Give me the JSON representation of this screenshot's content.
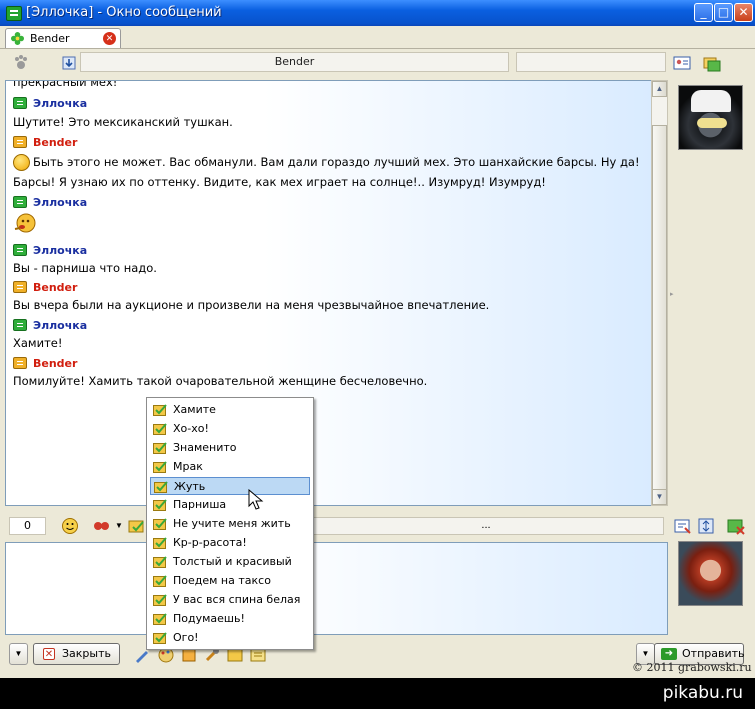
{
  "window": {
    "title": "[Эллочка] - Окно сообщений"
  },
  "tab": {
    "label": "Bender"
  },
  "contact": {
    "name": "Bender"
  },
  "chat": {
    "lines": [
      {
        "type": "text",
        "text": "прекрасный мех!"
      },
      {
        "type": "sender",
        "who": "e",
        "text": "Эллочка"
      },
      {
        "type": "text",
        "text": "Шутите! Это мексиканский тушкан."
      },
      {
        "type": "sender",
        "who": "b",
        "text": "Bender"
      },
      {
        "type": "text",
        "text": "Быть этого не может. Вас обманули. Вам дали гораздо лучший мех. Это шанхайские барсы. Ну да!"
      },
      {
        "type": "text",
        "text": "Барсы! Я узнаю их по оттенку. Видите, как мех играет на солнце!.. Изумруд! Изумруд!"
      },
      {
        "type": "sender",
        "who": "e",
        "text": "Эллочка"
      },
      {
        "type": "sender",
        "who": "e",
        "text": "Эллочка"
      },
      {
        "type": "text",
        "text": "Вы - парниша что надо."
      },
      {
        "type": "sender",
        "who": "b",
        "text": "Bender"
      },
      {
        "type": "text",
        "text": "Вы вчера были на аукционе и произвели на меня чрезвычайное впечатление."
      },
      {
        "type": "sender",
        "who": "e",
        "text": "Эллочка"
      },
      {
        "type": "text",
        "text": "Хамите!"
      },
      {
        "type": "sender",
        "who": "b",
        "text": "Bender"
      },
      {
        "type": "text",
        "text": "Помилуйте! Хамить такой очаровательной женщине бесчеловечно."
      }
    ]
  },
  "composer": {
    "counter": "0",
    "ellipsis": "..."
  },
  "popup": {
    "items": [
      "Хамите",
      "Хо-хо!",
      "Знаменито",
      "Мрак",
      "Жуть",
      "Парниша",
      "Не учите меня жить",
      "Кр-р-расота!",
      "Толстый и красивый",
      "Поедем на таксо",
      "У вас вся спина белая",
      "Подумаешь!",
      "Ого!"
    ],
    "selected": "Жуть"
  },
  "buttons": {
    "close": "Закрыть",
    "send": "Отправить"
  },
  "watermark": {
    "copyright": "© 2011 grabowski.ru",
    "site": "pikabu.ru"
  },
  "colors": {
    "titlebar": "#0a5fe0",
    "ella_name": "#1a2fa0",
    "bender_name": "#d11e0e",
    "selection": "#bcd9f4"
  }
}
